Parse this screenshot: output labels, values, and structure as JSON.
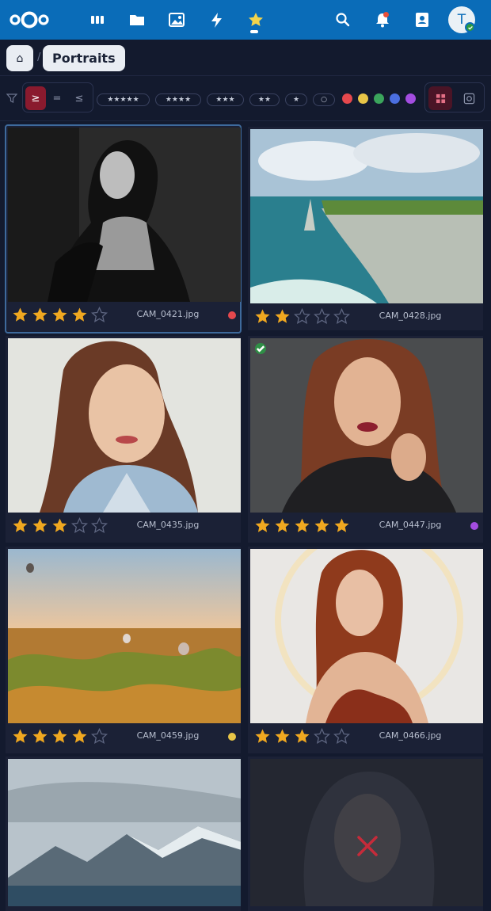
{
  "topbar": {
    "brand_color": "#0a6cb8",
    "apps": [
      {
        "name": "dashboard",
        "icon": "dashboard-icon"
      },
      {
        "name": "files",
        "icon": "folder-icon"
      },
      {
        "name": "photos",
        "icon": "image-icon"
      },
      {
        "name": "activity",
        "icon": "lightning-icon"
      },
      {
        "name": "favorites",
        "icon": "star-icon",
        "active": true
      }
    ],
    "user_initial": "T"
  },
  "breadcrumb": {
    "home_icon": "⌂",
    "separator": "/",
    "current": "Portraits"
  },
  "filter": {
    "comparators": [
      "≥",
      "=",
      "≤"
    ],
    "active_comparator": "≥",
    "star_chips": [
      "★★★★★",
      "★★★★",
      "★★★",
      "★★",
      "★",
      "○"
    ],
    "color_labels": [
      "#e5484d",
      "#e8c547",
      "#3ba55c",
      "#4b6fe0",
      "#a34de0"
    ],
    "views": [
      {
        "name": "grid",
        "icon": "grid-icon",
        "active": true
      },
      {
        "name": "loupe",
        "icon": "loupe-icon",
        "active": false
      }
    ]
  },
  "photos": [
    {
      "filename": "CAM_0421.jpg",
      "rating": 4,
      "label": "#e5484d",
      "selected": true,
      "picked": false,
      "rejected": false
    },
    {
      "filename": "CAM_0428.jpg",
      "rating": 2,
      "label": null,
      "selected": false,
      "picked": false,
      "rejected": false
    },
    {
      "filename": "CAM_0435.jpg",
      "rating": 3,
      "label": null,
      "selected": false,
      "picked": false,
      "rejected": false
    },
    {
      "filename": "CAM_0447.jpg",
      "rating": 5,
      "label": "#a34de0",
      "selected": false,
      "picked": true,
      "rejected": false
    },
    {
      "filename": "CAM_0459.jpg",
      "rating": 4,
      "label": "#e8c547",
      "selected": false,
      "picked": false,
      "rejected": false
    },
    {
      "filename": "CAM_0466.jpg",
      "rating": 3,
      "label": null,
      "selected": false,
      "picked": false,
      "rejected": false
    },
    {
      "filename": "",
      "rating": 0,
      "label": null,
      "selected": false,
      "picked": false,
      "rejected": false
    },
    {
      "filename": "",
      "rating": 0,
      "label": null,
      "selected": false,
      "picked": false,
      "rejected": true
    }
  ]
}
